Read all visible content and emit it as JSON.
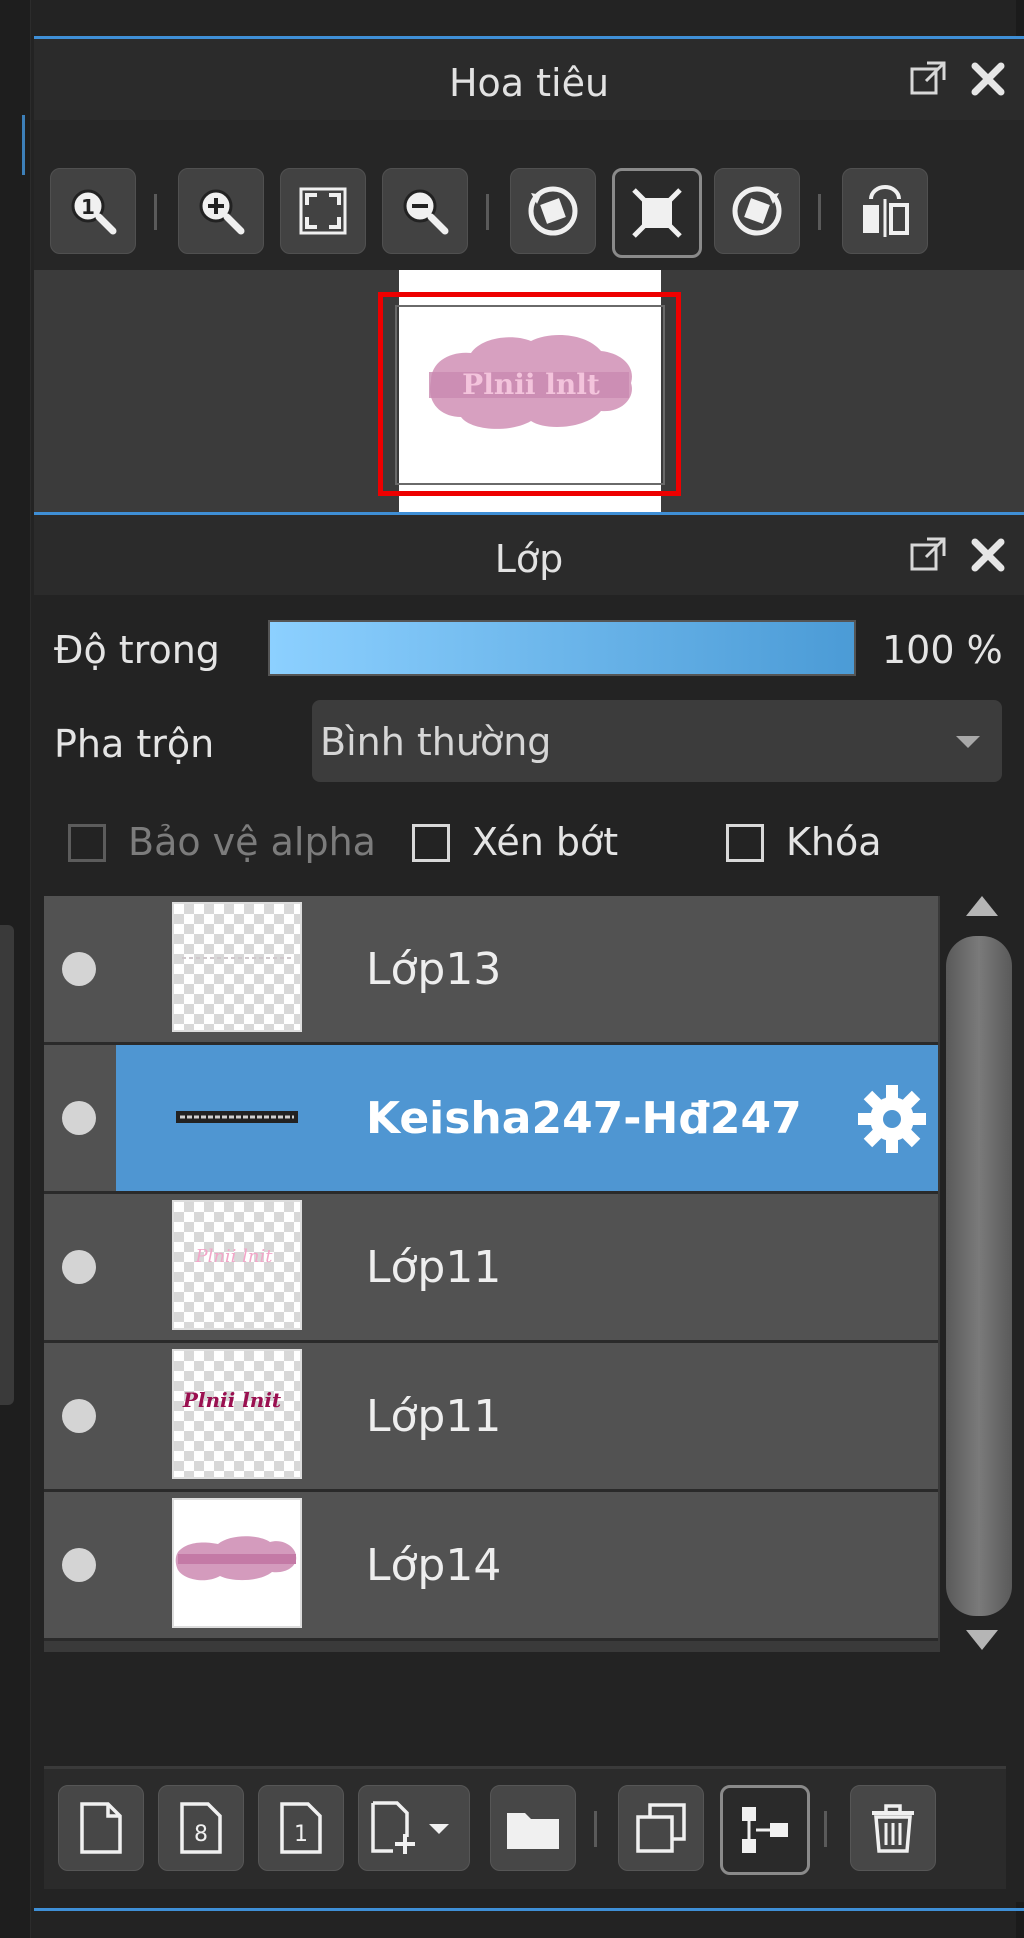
{
  "navigator": {
    "title": "Hoa tiêu",
    "tools": [
      "zoom-actual-size-icon",
      "zoom-in-icon",
      "fit-screen-icon",
      "zoom-out-icon",
      "rotate-left-icon",
      "reset-view-icon",
      "rotate-right-icon",
      "flip-horizontal-icon"
    ]
  },
  "layers_panel": {
    "title": "Lớp",
    "opacity_label": "Độ trong",
    "opacity_value": "100 %",
    "blend_label": "Pha trộn",
    "blend_value": "Bình thường",
    "protect_alpha_label": "Bảo vệ alpha",
    "clipping_label": "Xén bớt",
    "lock_label": "Khóa",
    "layers": [
      {
        "name": "Lớp13",
        "selected": false
      },
      {
        "name": "Keisha247-Hđ247",
        "selected": true
      },
      {
        "name": "Lớp11",
        "selected": false
      },
      {
        "name": "Lớp11",
        "selected": false
      },
      {
        "name": "Lớp14",
        "selected": false
      }
    ]
  },
  "colors": {
    "accent": "#3f8fd6",
    "selected_row": "#4f96d2",
    "viewport_frame": "#e00000",
    "opacity_bar_start": "#8cd0ff",
    "opacity_bar_end": "#4b9bd6"
  }
}
